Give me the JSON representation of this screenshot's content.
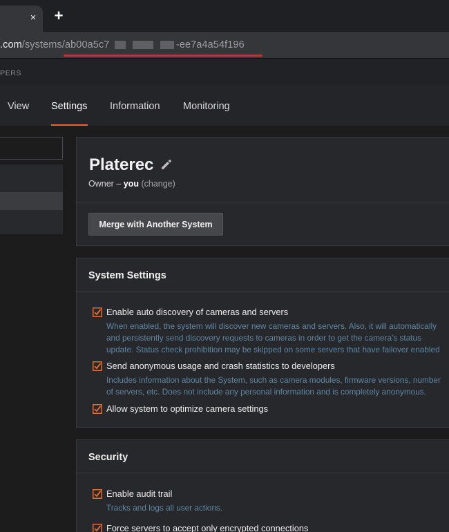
{
  "browser": {
    "tab_close_glyph": "×",
    "new_tab_glyph": "+",
    "url_host": ".com",
    "url_path": "/systems/ab00a5c7",
    "url_suffix": "-ee7a4a54f196"
  },
  "app": {
    "brand_text": "PERS",
    "nav": {
      "view": "View",
      "settings": "Settings",
      "information": "Information",
      "monitoring": "Monitoring"
    }
  },
  "system": {
    "name": "Platerec",
    "owner_prefix": "Owner –",
    "owner_value": "you",
    "change_link": "(change)",
    "merge_button": "Merge with Another System"
  },
  "system_settings": {
    "title": "System Settings",
    "options": [
      {
        "label": "Enable auto discovery of cameras and servers",
        "checked": true,
        "desc_lines": [
          "When enabled, the system will discover new cameras and servers. Also, it will automatically",
          "and persistently send discovery requests to cameras in order to get the camera's status",
          "update. Status check prohibition may be skipped on some servers that have failover enabled"
        ]
      },
      {
        "label": "Send anonymous usage and crash statistics to developers",
        "checked": true,
        "desc_lines": [
          "Includes information about the System, such as camera modules, firmware versions, number",
          "of servers, etc. Does not include any personal information and is completely anonymous."
        ]
      },
      {
        "label": "Allow system to optimize camera settings",
        "checked": true,
        "desc_lines": []
      }
    ]
  },
  "security": {
    "title": "Security",
    "options": [
      {
        "label": "Enable audit trail",
        "checked": true,
        "desc_lines": [
          "Tracks and logs all user actions."
        ]
      },
      {
        "label": "Force servers to accept only encrypted connections",
        "checked": true,
        "desc_lines": []
      }
    ]
  },
  "colors": {
    "accent_orange": "#e86a2c",
    "annotation_red": "#e8212b",
    "description_blue": "#5f86a3",
    "panel_bg": "#27282b",
    "page_bg": "#1c1c1d"
  },
  "icons": {
    "edit": "pencil-icon",
    "checkbox": "checkbox-checked-icon",
    "annotation_arrow": "red-arrow-icon"
  }
}
